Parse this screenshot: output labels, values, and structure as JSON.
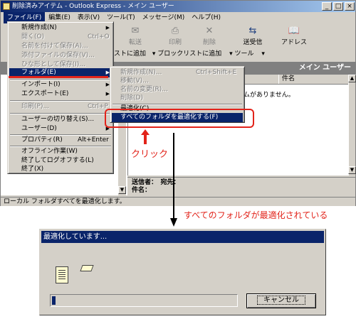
{
  "window": {
    "title": "削除済みアイテム - Outlook Express - メイン ユーザー"
  },
  "titlebar_buttons": [
    "_",
    "□",
    "×"
  ],
  "menubar": [
    "ファイル(F)",
    "編集(E)",
    "表示(V)",
    "ツール(T)",
    "メッセージ(M)",
    "ヘルプ(H)"
  ],
  "toolbar": {
    "forward": "転送",
    "print": "印刷",
    "delete": "削除",
    "sendrecv": "送受信",
    "address": "アドレス"
  },
  "bar2": {
    "add_contact": "リストに追加",
    "block": "▾ ブロックリストに追加",
    "tools": "▾ ツール",
    "tools_arrow": "▾"
  },
  "header": {
    "title": "メイン ユーザー",
    "col_subject": "件名"
  },
  "list": {
    "empty": "ムがありません。"
  },
  "preview": {
    "from": "送信者：　宛先：",
    "subject": "件名："
  },
  "status": "ローカル フォルダすべてを最適化します。",
  "file_menu": {
    "new": "新規作成(N)",
    "open": "開く(O)",
    "open_sc": "Ctrl+O",
    "saveas": "名前を付けて保存(A)...",
    "saveattach": "添付ファイルの保存(V)...",
    "savestationery": "ひな形として保存(I)...",
    "folder": "フォルダ(E)",
    "import": "インポート(I)",
    "export": "エクスポート(E)",
    "print": "印刷(P)...",
    "print_sc": "Ctrl+P",
    "switchuser": "ユーザーの切り替え(S)...",
    "user": "ユーザー(D)",
    "props": "プロパティ(R)",
    "props_sc": "Alt+Enter",
    "offline": "オフライン作業(W)",
    "logoff": "終了してログオフする(L)",
    "exit": "終了(X)"
  },
  "folder_menu": {
    "new": "新規作成(N)...",
    "new_sc": "Ctrl+Shift+E",
    "move": "移動(V)...",
    "rename": "名前の変更(R)...",
    "delete": "削除(D)",
    "compact": "最適化(C)",
    "compact_all": "すべてのフォルダを最適化する(F)"
  },
  "annotations": {
    "click": "クリック",
    "result": "すべてのフォルダが最適化されている"
  },
  "dialog": {
    "title": "最適化しています...",
    "cancel": "キャンセル",
    "progress_fraction": 0.02
  }
}
